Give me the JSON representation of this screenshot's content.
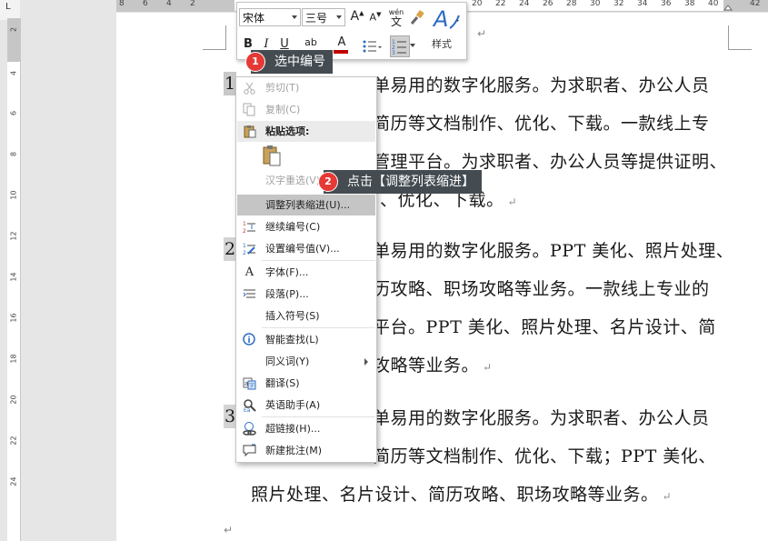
{
  "ruler": {
    "top_numbers": [
      "8",
      "6",
      "4",
      "2",
      "20",
      "22",
      "24",
      "26",
      "28",
      "30",
      "32",
      "34",
      "36",
      "38",
      "40",
      "42"
    ],
    "left_numbers": [
      "2",
      "4",
      "6",
      "8",
      "10",
      "12",
      "14",
      "16",
      "18",
      "20",
      "22",
      "24"
    ]
  },
  "mini_toolbar": {
    "font_name": "宋体",
    "font_size": "三号",
    "grow_font": "A",
    "shrink_font": "A",
    "phonetic_top": "wén",
    "phonetic_bottom": "文",
    "bold": "B",
    "italic": "I",
    "underline": "U",
    "highlight": "ab",
    "font_color": "A",
    "styles_label": "样式"
  },
  "callouts": [
    {
      "number": "1",
      "text": "选中编号"
    },
    {
      "number": "2",
      "text": "点击【调整列表缩进】"
    }
  ],
  "document": {
    "paragraphs": [
      {
        "number": "1",
        "lines": [
          "单易用的数字化服务。为求职者、办公人员",
          "简历等文档制作、优化、下载。一款线上专",
          "管理平台。为求职者、办公人员等提供证明、",
          "、优化、下载。"
        ]
      },
      {
        "number": "2",
        "lines": [
          "单易用的数字化服务。PPT 美化、照片处理、",
          "历攻略、职场攻略等业务。一款线上专业的",
          "平台。PPT 美化、照片处理、名片设计、简",
          "攻略等业务。"
        ]
      },
      {
        "number": "3",
        "lines": [
          "单易用的数字化服务。为求职者、办公人员",
          "简历等文档制作、优化、下载；PPT 美化、",
          "照片处理、名片设计、简历攻略、职场攻略等业务。"
        ]
      }
    ],
    "paragraph_mark": "↵"
  },
  "context_menu": {
    "cut": "剪切(T)",
    "copy": "复制(C)",
    "paste_options": "粘贴选项:",
    "reconvert": "汉字重选(V)",
    "adjust_list_indent": "调整列表缩进(U)...",
    "continue_numbering": "继续编号(C)",
    "set_numbering_value": "设置编号值(V)...",
    "font": "字体(F)...",
    "paragraph": "段落(P)...",
    "insert_symbol": "插入符号(S)",
    "smart_lookup": "智能查找(L)",
    "synonyms": "同义词(Y)",
    "translate": "翻译(S)",
    "english_assistant": "英语助手(A)",
    "hyperlink": "超链接(H)...",
    "new_comment": "新建批注(M)"
  },
  "colors": {
    "callout_bg": "#444c52",
    "badge_red": "#e53935",
    "menu_highlight": "#c5c5c5",
    "style_icon_blue": "#2b6cc4"
  }
}
